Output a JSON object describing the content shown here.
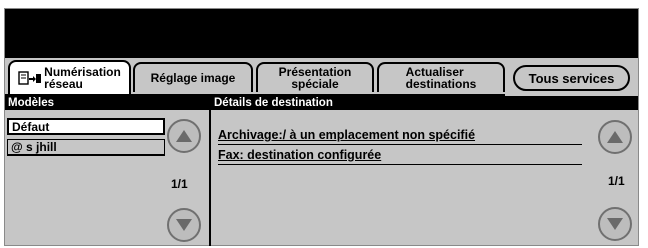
{
  "tabs": [
    {
      "label_line1": "Numérisation",
      "label_line2": "réseau",
      "icon": "scan-to-network-icon",
      "active": true
    },
    {
      "label": "Réglage image"
    },
    {
      "label_line1": "Présentation",
      "label_line2": "spéciale"
    },
    {
      "label_line1": "Actualiser",
      "label_line2": "destinations"
    }
  ],
  "all_services_label": "Tous services",
  "templates_panel": {
    "header": "Modèles",
    "items": [
      "Défaut",
      "@ s jhill"
    ],
    "selected_index": 0,
    "page": "1/1"
  },
  "details_panel": {
    "header": "Détails de destination",
    "lines": [
      "Archivage:/  à un emplacement non spécifié",
      "Fax: destination configurée"
    ],
    "page": "1/1"
  },
  "icons": {
    "up": "up-arrow-icon",
    "down": "down-arrow-icon"
  }
}
